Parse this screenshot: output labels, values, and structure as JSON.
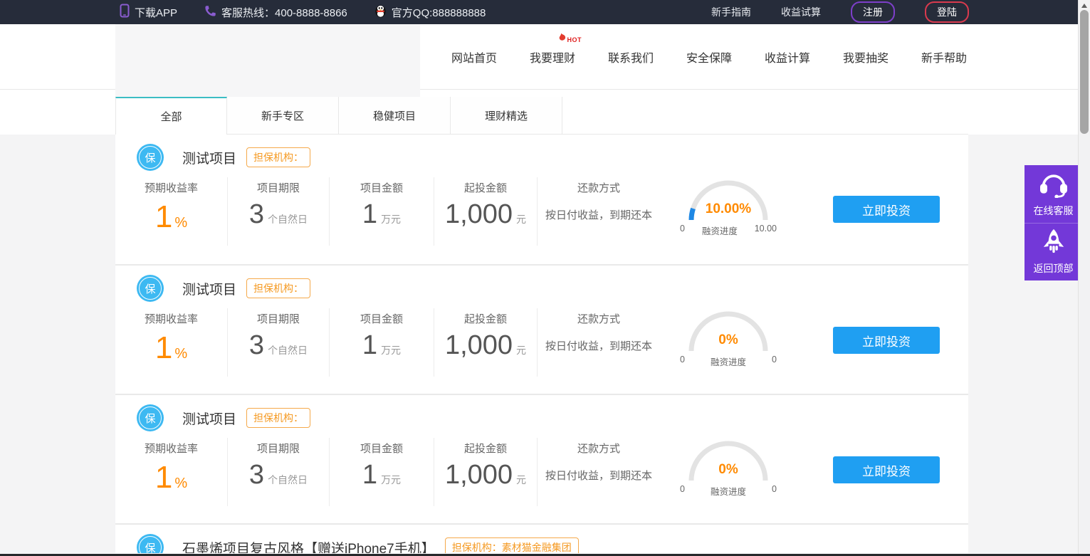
{
  "topbar": {
    "download_app": "下载APP",
    "hotline": "客服热线：400-8888-8866",
    "qq": "官方QQ:888888888",
    "links": [
      {
        "label": "新手指南"
      },
      {
        "label": "收益试算"
      }
    ],
    "register_label": "注册",
    "login_label": "登陆"
  },
  "nav": {
    "hot_badge": "HOT",
    "items": [
      {
        "label": "网站首页"
      },
      {
        "label": "我要理财",
        "hot": true
      },
      {
        "label": "联系我们"
      },
      {
        "label": "安全保障"
      },
      {
        "label": "收益计算"
      },
      {
        "label": "我要抽奖"
      },
      {
        "label": "新手帮助"
      }
    ]
  },
  "tabs": [
    {
      "label": "全部",
      "active": true
    },
    {
      "label": "新手专区"
    },
    {
      "label": "稳健项目"
    },
    {
      "label": "理财精选"
    }
  ],
  "projects": [
    {
      "badge": "保",
      "title": "测试项目",
      "guarantee_tag": "担保机构：",
      "fields": [
        {
          "label": "预期收益率",
          "value": "1",
          "unit": "%"
        },
        {
          "label": "项目期限",
          "value": "3",
          "unit": "个自然日"
        },
        {
          "label": "项目金额",
          "value": "1",
          "unit": "万元"
        },
        {
          "label": "起投金额",
          "value": "1,000",
          "unit": "元"
        }
      ],
      "repayment_label": "还款方式",
      "repayment_value": "按日付收益，到期还本",
      "progress": {
        "percent": 10,
        "percent_label": "10.00%",
        "min": "0",
        "caption": "融资进度",
        "max": "10.00"
      },
      "invest_button": "立即投资"
    },
    {
      "badge": "保",
      "title": "测试项目",
      "guarantee_tag": "担保机构：",
      "fields": [
        {
          "label": "预期收益率",
          "value": "1",
          "unit": "%"
        },
        {
          "label": "项目期限",
          "value": "3",
          "unit": "个自然日"
        },
        {
          "label": "项目金额",
          "value": "1",
          "unit": "万元"
        },
        {
          "label": "起投金额",
          "value": "1,000",
          "unit": "元"
        }
      ],
      "repayment_label": "还款方式",
      "repayment_value": "按日付收益，到期还本",
      "progress": {
        "percent": 0,
        "percent_label": "0%",
        "min": "0",
        "caption": "融资进度",
        "max": "0"
      },
      "invest_button": "立即投资"
    },
    {
      "badge": "保",
      "title": "测试项目",
      "guarantee_tag": "担保机构：",
      "fields": [
        {
          "label": "预期收益率",
          "value": "1",
          "unit": "%"
        },
        {
          "label": "项目期限",
          "value": "3",
          "unit": "个自然日"
        },
        {
          "label": "项目金额",
          "value": "1",
          "unit": "万元"
        },
        {
          "label": "起投金额",
          "value": "1,000",
          "unit": "元"
        }
      ],
      "repayment_label": "还款方式",
      "repayment_value": "按日付收益，到期还本",
      "progress": {
        "percent": 0,
        "percent_label": "0%",
        "min": "0",
        "caption": "融资进度",
        "max": "0"
      },
      "invest_button": "立即投资"
    },
    {
      "badge": "保",
      "title": "石墨烯项目复古风格【赠送iPhone7手机】",
      "guarantee_tag": "担保机构：素材猫金融集团"
    }
  ],
  "floating": {
    "online_service": "在线客服",
    "back_to_top": "返回顶部"
  },
  "colors": {
    "topbar_bg": "#262c3a",
    "register_border": "#7d3fc9",
    "login_border": "#d93a4e",
    "hot_red": "#e02020",
    "tab_active_teal": "#3bbdc4",
    "badge_blue": "#3db9f2",
    "tag_orange": "#f59a23",
    "accent_orange": "#ff8a00",
    "gauge_track": "#e3e3e3",
    "gauge_fill_blue": "#1e88e5",
    "invest_blue": "#1f9ff2",
    "widget_purple": "#7338d8"
  }
}
